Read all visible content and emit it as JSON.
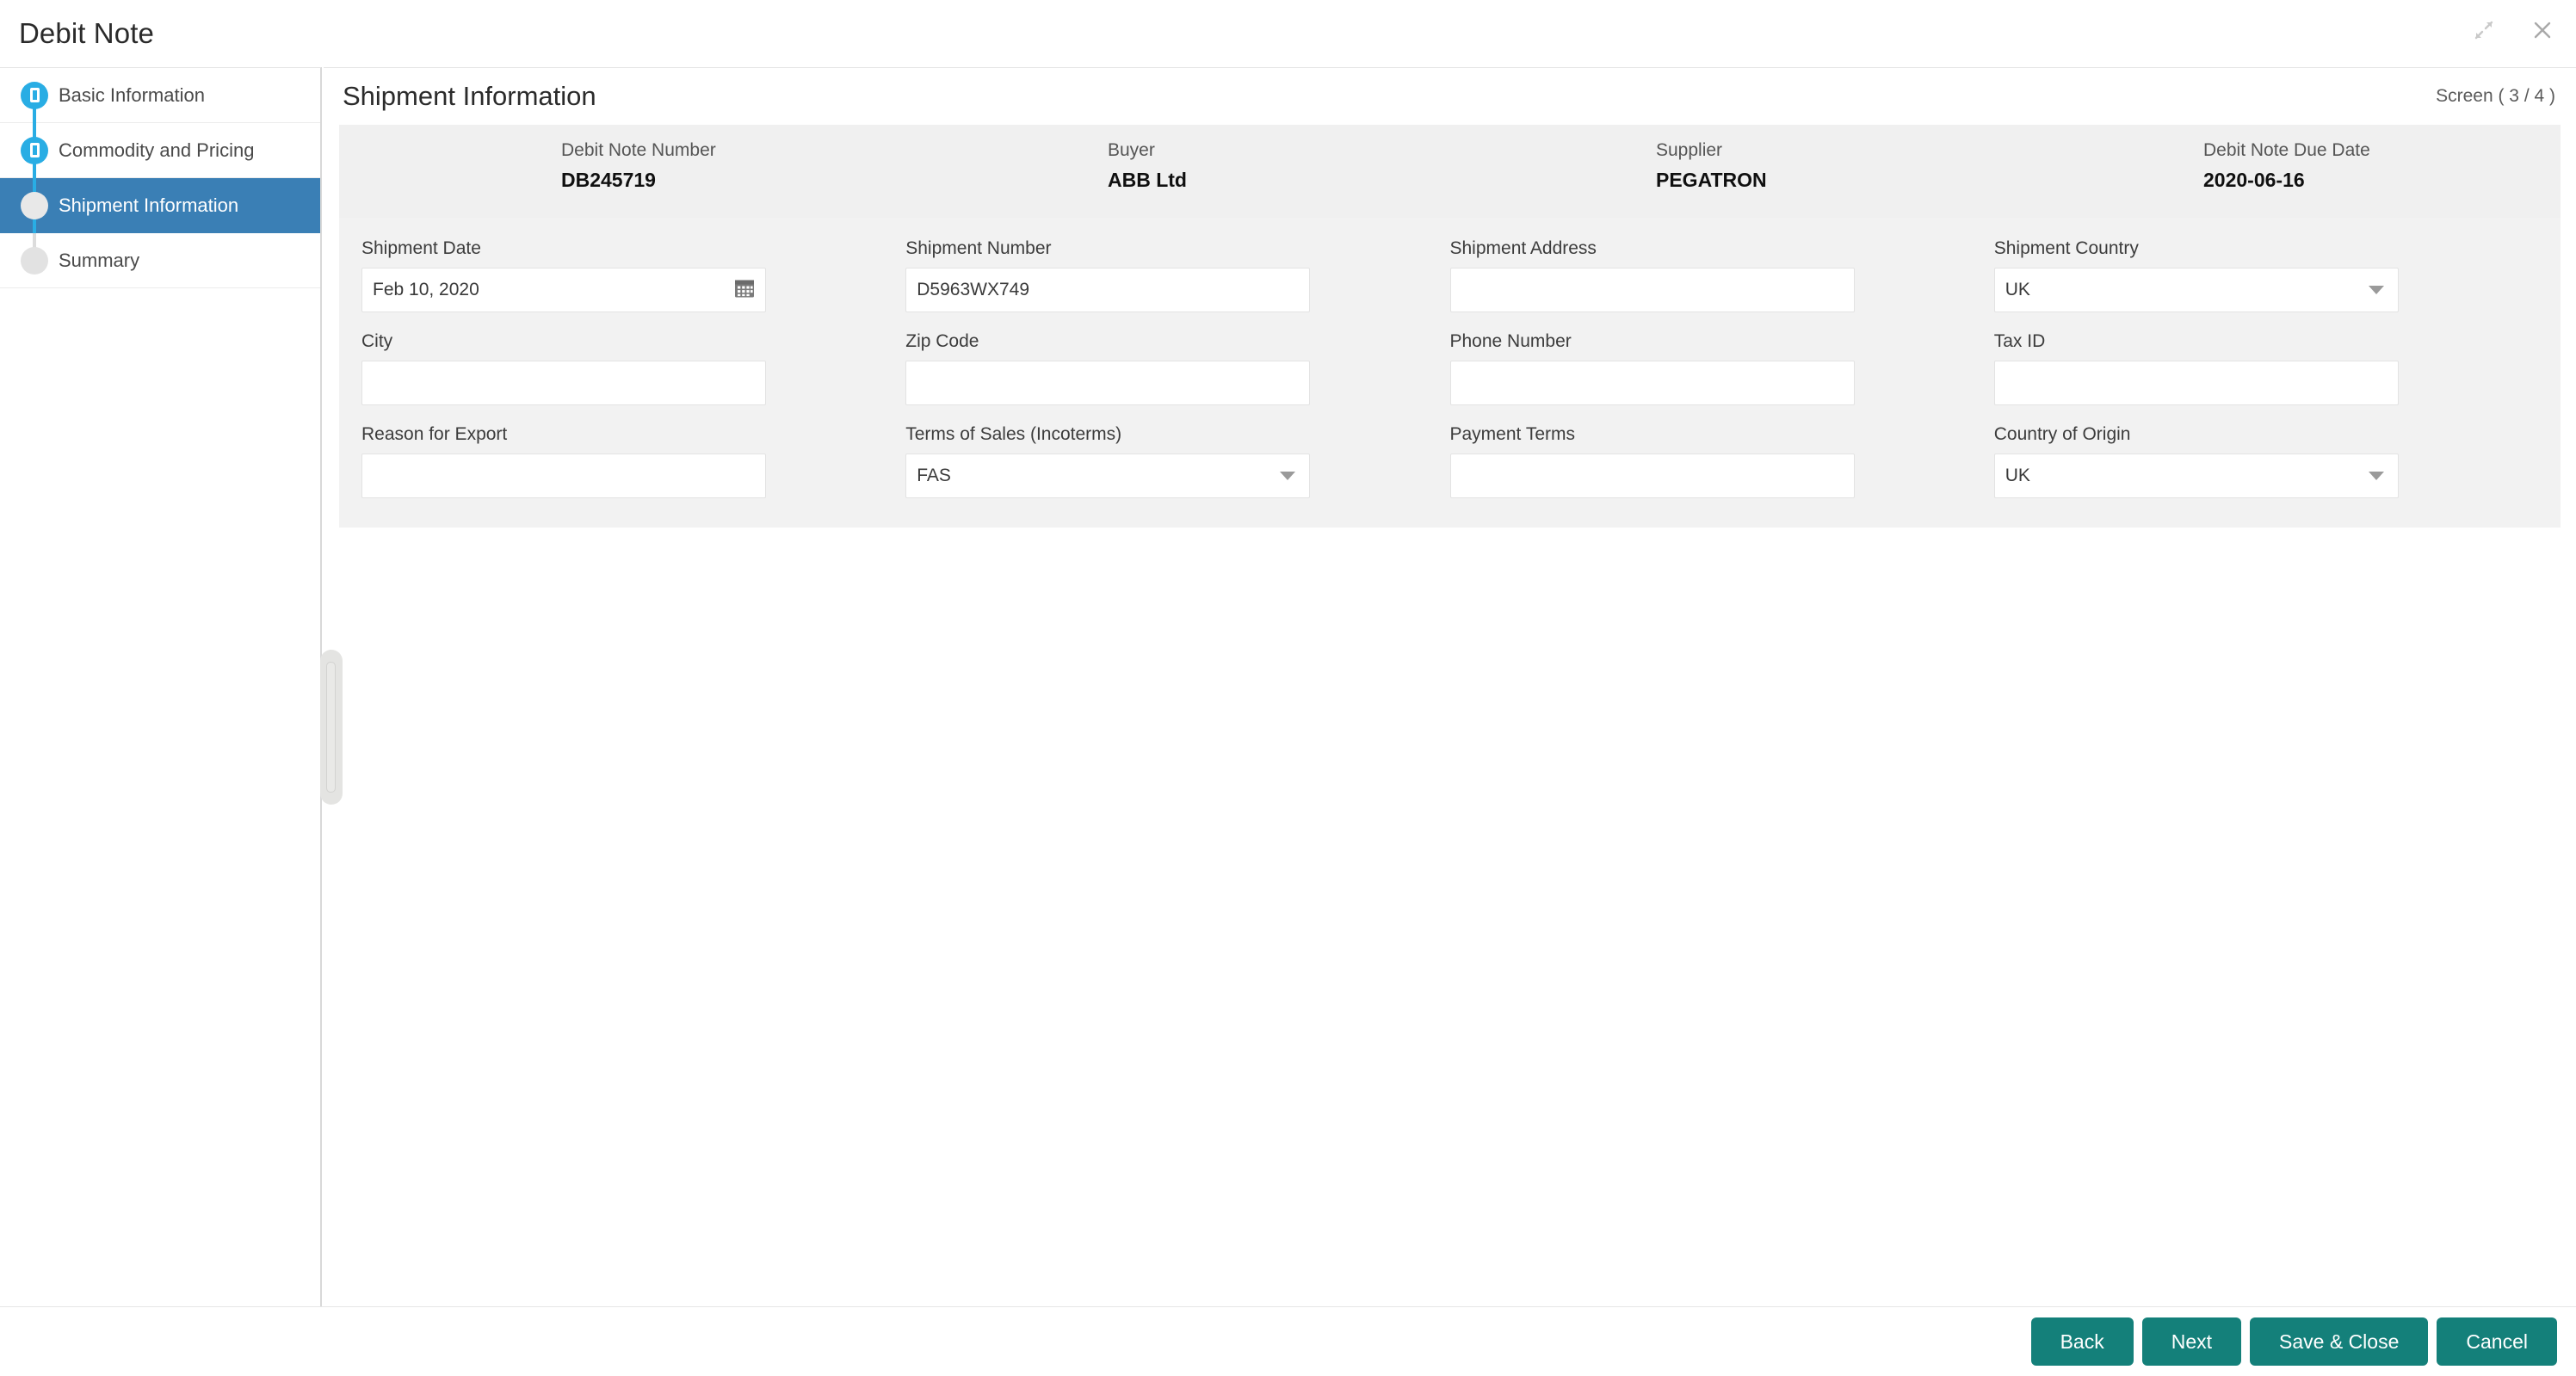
{
  "window": {
    "title": "Debit Note",
    "restore_icon": "restore-window-icon",
    "close_icon": "close-icon"
  },
  "sidebar": {
    "steps": [
      {
        "label": "Basic Information",
        "state": "done"
      },
      {
        "label": "Commodity and Pricing",
        "state": "done"
      },
      {
        "label": "Shipment Information",
        "state": "active"
      },
      {
        "label": "Summary",
        "state": "pending"
      }
    ]
  },
  "panel": {
    "title": "Shipment Information",
    "screen_counter": "Screen ( 3 / 4 )"
  },
  "summary": {
    "items": [
      {
        "label": "Debit Note Number",
        "value": "DB245719"
      },
      {
        "label": "Buyer",
        "value": "ABB Ltd"
      },
      {
        "label": "Supplier",
        "value": "PEGATRON"
      },
      {
        "label": "Debit Note Due Date",
        "value": "2020-06-16"
      }
    ]
  },
  "form": {
    "rows": [
      [
        {
          "label": "Shipment Date",
          "value": "Feb 10, 2020",
          "type": "date",
          "placeholder": ""
        },
        {
          "label": "Shipment Number",
          "value": "D5963WX749",
          "type": "text",
          "placeholder": ""
        },
        {
          "label": "Shipment Address",
          "value": "",
          "type": "text",
          "placeholder": ""
        },
        {
          "label": "Shipment Country",
          "value": "UK",
          "type": "select",
          "placeholder": ""
        }
      ],
      [
        {
          "label": "City",
          "value": "",
          "type": "text",
          "placeholder": ""
        },
        {
          "label": "Zip Code",
          "value": "",
          "type": "text",
          "placeholder": ""
        },
        {
          "label": "Phone Number",
          "value": "",
          "type": "text",
          "placeholder": ""
        },
        {
          "label": "Tax ID",
          "value": "",
          "type": "text",
          "placeholder": ""
        }
      ],
      [
        {
          "label": "Reason for Export",
          "value": "",
          "type": "text",
          "placeholder": ""
        },
        {
          "label": "Terms of Sales (Incoterms)",
          "value": "FAS",
          "type": "select",
          "placeholder": ""
        },
        {
          "label": "Payment Terms",
          "value": "",
          "type": "text",
          "placeholder": ""
        },
        {
          "label": "Country of Origin",
          "value": "UK",
          "type": "select",
          "placeholder": ""
        }
      ]
    ]
  },
  "footer": {
    "buttons": [
      {
        "label": "Back",
        "name": "back-button"
      },
      {
        "label": "Next",
        "name": "next-button"
      },
      {
        "label": "Save & Close",
        "name": "save-and-close-button"
      },
      {
        "label": "Cancel",
        "name": "cancel-button"
      }
    ]
  },
  "colors": {
    "accent_teal": "#14807a",
    "step_done": "#29ade4",
    "step_active_row": "#3a7fb5",
    "panel_grey": "#f2f2f2",
    "summary_grey": "#f0f0f0"
  }
}
